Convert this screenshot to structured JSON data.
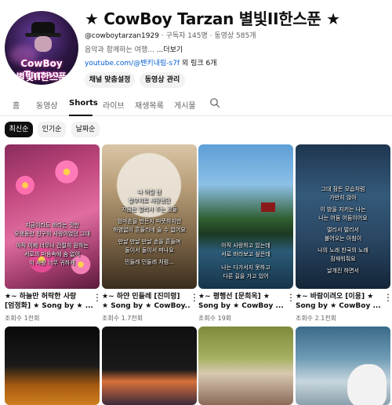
{
  "channel": {
    "name": "★ CowBoy Tarzan 별빛II한스푼 ★",
    "avatar_text_1": "CowBoy Tarzan",
    "avatar_text_2": "별빛II한스푼",
    "handle": "@cowboytarzan1929",
    "subscribers": "구독자 145명",
    "videos": "동영상 585개",
    "description": "음악과 함께하는 여행...",
    "more": "...더보기",
    "link_url": "youtube.com/@밴키내림-s7f",
    "link_more": "외 링크 6개",
    "buttons": {
      "customize": "채널 맞춤설정",
      "manage": "동영상 관리"
    }
  },
  "tabs": [
    "홈",
    "동영상",
    "Shorts",
    "라이브",
    "재생목록",
    "게시물"
  ],
  "chips": [
    "최신순",
    "인기순",
    "날짜순"
  ],
  "shorts": [
    {
      "title1": "★~ 하늘만 허락한 사랑",
      "title2": "[엄정화] ★ Song by ★ ...",
      "views": "조회수 1천회",
      "overlay": [
        "지금이라도 바라는 것만",
        "오랫동안 친구의 사랑이었던 그대",
        "",
        "아직 이제 너무나 간절히 원하는",
        "서로의 마음속에 숨 없어",
        "이 사랑 너무 귀하게"
      ]
    },
    {
      "title1": "★~ 하얀 민들레 [진미령]",
      "title2": "★ Song by ★ CowBoy...",
      "views": "조회수 1.7천회",
      "overlay": [
        "나 어릴 땐",
        "철부지로 사랑했던",
        "지금은 멀리서 주는 것들",
        "",
        "엄마손을 만든지 따뜻하지만",
        "하염없이 흔들리네 슬 수 없어요",
        "",
        "만날 만날 만날 손을 흔들며",
        "둘이서 둘이서 떠나요",
        "",
        "민들레 민들레 처럼..."
      ]
    },
    {
      "title1": "★~ 평행선 [문희옥] ★",
      "title2": "Song by ★ CowBoy ...",
      "views": "조회수 19회",
      "overlay": [
        "아직 사랑하고 있는데",
        "서로 바라보고 싶은데",
        "",
        "나는 다가서지 못하고",
        "다른 길을 가고 있어"
      ]
    },
    {
      "title1": "★~ 바람이려오 [이용] ★",
      "title2": "Song by ★ CowBoy ...",
      "views": "조회수 2.1천회",
      "overlay": [
        "그대 잠든 모습처럼",
        "가만히 앉아",
        "",
        "이 밤을 지키는 나는",
        "나는 어둠 어둠이어요",
        "",
        "멀리서 멀리서",
        "불어오는 아침이",
        "",
        "나의 노래 찬국의 노래",
        "잠재워줘요",
        "",
        "날개진 하면서"
      ]
    }
  ],
  "row2": [
    {
      "name": "autumn-forest-thumbnail"
    },
    {
      "name": "city-sunset-thumbnail"
    },
    {
      "name": "couple-portrait-thumbnail"
    },
    {
      "name": "seagull-beach-thumbnail"
    }
  ]
}
